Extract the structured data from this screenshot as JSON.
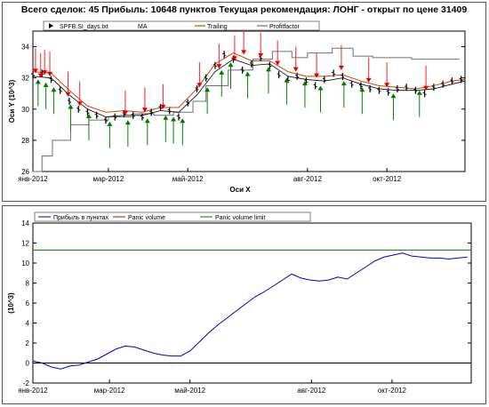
{
  "chart_data": [
    {
      "type": "line",
      "title": "Всего сделок:  45 Прибыль: 10648 пунктов   Текущая рекомендация: ЛОНГ - открыт по цене 31409",
      "xlabel": "Оси X",
      "ylabel": "Оси Y (10^3)",
      "ylim": [
        26,
        35
      ],
      "yticks": [
        26,
        28,
        30,
        32,
        34
      ],
      "xlim": [
        "2012-01-03",
        "2012-11-30"
      ],
      "xticks": [
        {
          "date": "2012-01-01",
          "label": "янв-2012"
        },
        {
          "date": "2012-03-01",
          "label": "мар-2012"
        },
        {
          "date": "2012-05-01",
          "label": "май-2012"
        },
        {
          "date": "2012-08-01",
          "label": "авг-2012"
        },
        {
          "date": "2012-10-01",
          "label": "окт-2012"
        }
      ],
      "grid": false,
      "legend_position": "top",
      "legend": [
        {
          "name": "SPFB.SI_days.txt",
          "marker": "tri-right"
        },
        {
          "name": "MA",
          "marker": "none"
        },
        {
          "name": "Trailing",
          "color": "#d04010"
        },
        {
          "name": "Profitfactor",
          "color": "#707070"
        }
      ],
      "series": [
        {
          "name": "SPFB.SI_days.txt",
          "style": "ohlc-bars",
          "color": "#000000",
          "x": [
            "2012-01-03",
            "2012-01-10",
            "2012-01-17",
            "2012-01-24",
            "2012-01-31",
            "2012-02-07",
            "2012-02-14",
            "2012-02-21",
            "2012-02-28",
            "2012-03-06",
            "2012-03-13",
            "2012-03-20",
            "2012-03-27",
            "2012-04-03",
            "2012-04-10",
            "2012-04-17",
            "2012-04-24",
            "2012-05-01",
            "2012-05-08",
            "2012-05-15",
            "2012-05-22",
            "2012-05-29",
            "2012-06-05",
            "2012-06-12",
            "2012-06-19",
            "2012-06-26",
            "2012-07-03",
            "2012-07-10",
            "2012-07-17",
            "2012-07-24",
            "2012-07-31",
            "2012-08-07",
            "2012-08-14",
            "2012-08-21",
            "2012-08-28",
            "2012-09-04",
            "2012-09-11",
            "2012-09-18",
            "2012-09-25",
            "2012-10-02",
            "2012-10-09",
            "2012-10-16",
            "2012-10-23",
            "2012-10-30",
            "2012-11-06",
            "2012-11-13",
            "2012-11-20",
            "2012-11-27"
          ],
          "values": [
            32.2,
            32.3,
            31.9,
            31.2,
            30.5,
            30.0,
            29.8,
            29.6,
            29.3,
            29.5,
            29.7,
            29.6,
            29.5,
            29.8,
            30.1,
            29.9,
            29.5,
            30.4,
            31.3,
            32.0,
            32.8,
            33.5,
            33.2,
            32.5,
            32.9,
            33.3,
            32.8,
            32.2,
            31.9,
            32.1,
            31.8,
            31.5,
            31.9,
            32.3,
            32.1,
            31.6,
            31.5,
            31.3,
            31.2,
            31.1,
            31.3,
            31.4,
            31.2,
            31.0,
            31.4,
            31.6,
            31.8,
            31.9
          ]
        },
        {
          "name": "MA",
          "style": "line",
          "color": "#000000",
          "x": [
            "2012-01-03",
            "2012-01-17",
            "2012-01-31",
            "2012-02-14",
            "2012-02-28",
            "2012-03-13",
            "2012-03-27",
            "2012-04-10",
            "2012-04-24",
            "2012-05-08",
            "2012-05-22",
            "2012-06-05",
            "2012-06-19",
            "2012-07-03",
            "2012-07-17",
            "2012-07-31",
            "2012-08-14",
            "2012-08-28",
            "2012-09-11",
            "2012-09-25",
            "2012-10-09",
            "2012-10-23",
            "2012-11-06",
            "2012-11-20",
            "2012-11-30"
          ],
          "values": [
            32.1,
            32.0,
            30.9,
            30.0,
            29.5,
            29.6,
            29.6,
            29.9,
            29.8,
            30.9,
            32.4,
            33.2,
            32.8,
            32.9,
            32.1,
            31.9,
            31.8,
            32.0,
            31.6,
            31.3,
            31.2,
            31.2,
            31.3,
            31.6,
            31.8
          ]
        },
        {
          "name": "Trailing",
          "style": "line",
          "color": "#d04010",
          "x": [
            "2012-01-03",
            "2012-01-17",
            "2012-01-31",
            "2012-02-14",
            "2012-02-28",
            "2012-03-13",
            "2012-03-27",
            "2012-04-10",
            "2012-04-24",
            "2012-05-08",
            "2012-05-22",
            "2012-06-05",
            "2012-06-19",
            "2012-07-03",
            "2012-07-17",
            "2012-07-31",
            "2012-08-14",
            "2012-08-28",
            "2012-09-11",
            "2012-09-25",
            "2012-10-09",
            "2012-10-23",
            "2012-11-06",
            "2012-11-20",
            "2012-11-30"
          ],
          "values": [
            32.4,
            32.3,
            31.2,
            30.2,
            29.8,
            29.9,
            29.8,
            30.1,
            30.1,
            31.3,
            32.9,
            33.6,
            33.1,
            33.1,
            32.4,
            32.1,
            32.1,
            32.2,
            31.8,
            31.5,
            31.4,
            31.3,
            31.5,
            31.8,
            31.9
          ]
        },
        {
          "name": "Profitfactor",
          "style": "step",
          "color": "#707070",
          "x": [
            "2012-01-03",
            "2012-01-10",
            "2012-01-18",
            "2012-02-01",
            "2012-02-15",
            "2012-03-01",
            "2012-03-20",
            "2012-04-05",
            "2012-04-20",
            "2012-05-05",
            "2012-05-15",
            "2012-06-01",
            "2012-06-20",
            "2012-07-05",
            "2012-07-20",
            "2012-08-01",
            "2012-08-20",
            "2012-09-05",
            "2012-09-20",
            "2012-10-05",
            "2012-10-20",
            "2012-11-05",
            "2012-11-20"
          ],
          "values": [
            26.0,
            27.0,
            28.0,
            29.0,
            29.3,
            29.5,
            29.7,
            29.6,
            29.8,
            30.5,
            31.5,
            32.5,
            33.2,
            33.7,
            33.3,
            33.6,
            33.9,
            33.4,
            33.3,
            33.3,
            33.2,
            33.2,
            33.2
          ]
        }
      ],
      "sell_signals": [
        {
          "date": "2012-01-05",
          "value": 32.3
        },
        {
          "date": "2012-01-09",
          "value": 32.0
        },
        {
          "date": "2012-01-12",
          "value": 32.2
        },
        {
          "date": "2012-01-16",
          "value": 32.1
        },
        {
          "date": "2012-01-30",
          "value": 30.8
        },
        {
          "date": "2012-02-08",
          "value": 30.2
        },
        {
          "date": "2012-03-14",
          "value": 29.6
        },
        {
          "date": "2012-03-29",
          "value": 29.8
        },
        {
          "date": "2012-04-12",
          "value": 30.0
        },
        {
          "date": "2012-05-10",
          "value": 31.4
        },
        {
          "date": "2012-05-25",
          "value": 32.6
        },
        {
          "date": "2012-06-06",
          "value": 33.1
        },
        {
          "date": "2012-06-13",
          "value": 33.5
        },
        {
          "date": "2012-06-26",
          "value": 33.3
        },
        {
          "date": "2012-07-09",
          "value": 32.8
        },
        {
          "date": "2012-07-23",
          "value": 32.4
        },
        {
          "date": "2012-08-08",
          "value": 32.0
        },
        {
          "date": "2012-08-27",
          "value": 32.5
        },
        {
          "date": "2012-09-17",
          "value": 31.7
        },
        {
          "date": "2012-10-01",
          "value": 31.4
        },
        {
          "date": "2012-10-31",
          "value": 31.2
        }
      ],
      "buy_signals": [
        {
          "date": "2012-01-07",
          "value": 31.9
        },
        {
          "date": "2012-01-13",
          "value": 31.7
        },
        {
          "date": "2012-01-19",
          "value": 31.4
        },
        {
          "date": "2012-02-01",
          "value": 30.3
        },
        {
          "date": "2012-02-15",
          "value": 29.7
        },
        {
          "date": "2012-03-02",
          "value": 29.2
        },
        {
          "date": "2012-03-16",
          "value": 29.3
        },
        {
          "date": "2012-03-31",
          "value": 29.4
        },
        {
          "date": "2012-04-14",
          "value": 29.6
        },
        {
          "date": "2012-04-20",
          "value": 29.5
        },
        {
          "date": "2012-04-27",
          "value": 29.4
        },
        {
          "date": "2012-05-16",
          "value": 31.4
        },
        {
          "date": "2012-05-27",
          "value": 32.5
        },
        {
          "date": "2012-06-03",
          "value": 33.0
        },
        {
          "date": "2012-06-16",
          "value": 32.4
        },
        {
          "date": "2012-07-02",
          "value": 32.7
        },
        {
          "date": "2012-07-16",
          "value": 32.0
        },
        {
          "date": "2012-07-30",
          "value": 31.8
        },
        {
          "date": "2012-08-11",
          "value": 31.5
        },
        {
          "date": "2012-08-29",
          "value": 31.8
        },
        {
          "date": "2012-09-12",
          "value": 31.4
        },
        {
          "date": "2012-10-06",
          "value": 31.0
        },
        {
          "date": "2012-10-26",
          "value": 31.2
        }
      ]
    },
    {
      "type": "line",
      "ylabel": "(10^3)",
      "ylim": [
        -2,
        14
      ],
      "yticks": [
        -2,
        0,
        2,
        4,
        6,
        8,
        10,
        12,
        14
      ],
      "xlim": [
        "2012-01-03",
        "2012-11-30"
      ],
      "xticks": [
        {
          "date": "2012-01-01",
          "label": "янв-2012"
        },
        {
          "date": "2012-03-01",
          "label": "мар-2012"
        },
        {
          "date": "2012-05-01",
          "label": "май-2012"
        },
        {
          "date": "2012-08-01",
          "label": "авг-2012"
        },
        {
          "date": "2012-10-01",
          "label": "окт-2012"
        }
      ],
      "grid": false,
      "legend_position": "top",
      "series": [
        {
          "name": "Прибыль в пунктах",
          "color": "#0000cc",
          "x": [
            "2012-01-03",
            "2012-01-10",
            "2012-01-17",
            "2012-01-24",
            "2012-01-31",
            "2012-02-07",
            "2012-02-14",
            "2012-02-21",
            "2012-02-28",
            "2012-03-06",
            "2012-03-13",
            "2012-03-20",
            "2012-03-27",
            "2012-04-03",
            "2012-04-10",
            "2012-04-17",
            "2012-04-24",
            "2012-05-01",
            "2012-05-08",
            "2012-05-15",
            "2012-05-22",
            "2012-05-29",
            "2012-06-05",
            "2012-06-12",
            "2012-06-19",
            "2012-06-26",
            "2012-07-03",
            "2012-07-10",
            "2012-07-17",
            "2012-07-24",
            "2012-07-31",
            "2012-08-07",
            "2012-08-14",
            "2012-08-21",
            "2012-08-28",
            "2012-09-04",
            "2012-09-11",
            "2012-09-18",
            "2012-09-25",
            "2012-10-02",
            "2012-10-09",
            "2012-10-16",
            "2012-10-23",
            "2012-10-30",
            "2012-11-06",
            "2012-11-13",
            "2012-11-20",
            "2012-11-27"
          ],
          "values": [
            0.2,
            0.0,
            -0.4,
            -0.6,
            -0.3,
            -0.2,
            0.1,
            0.4,
            0.9,
            1.4,
            1.7,
            1.6,
            1.3,
            1.0,
            0.8,
            0.7,
            0.7,
            1.2,
            2.1,
            3.0,
            3.8,
            4.5,
            5.2,
            5.9,
            6.6,
            7.1,
            7.7,
            8.3,
            8.9,
            8.5,
            8.3,
            8.2,
            8.3,
            8.6,
            8.4,
            9.0,
            9.6,
            10.2,
            10.6,
            10.8,
            11.0,
            10.7,
            10.6,
            10.5,
            10.5,
            10.4,
            10.5,
            10.6
          ]
        },
        {
          "name": "Panic volume",
          "color": "#cc0000",
          "x": [
            "2012-01-03",
            "2012-11-30"
          ],
          "values": [
            0.0,
            0.0
          ]
        },
        {
          "name": "Panic volume limit",
          "color": "#007700",
          "x": [
            "2012-01-03",
            "2012-11-30"
          ],
          "values": [
            11.3,
            11.3
          ]
        }
      ]
    }
  ]
}
